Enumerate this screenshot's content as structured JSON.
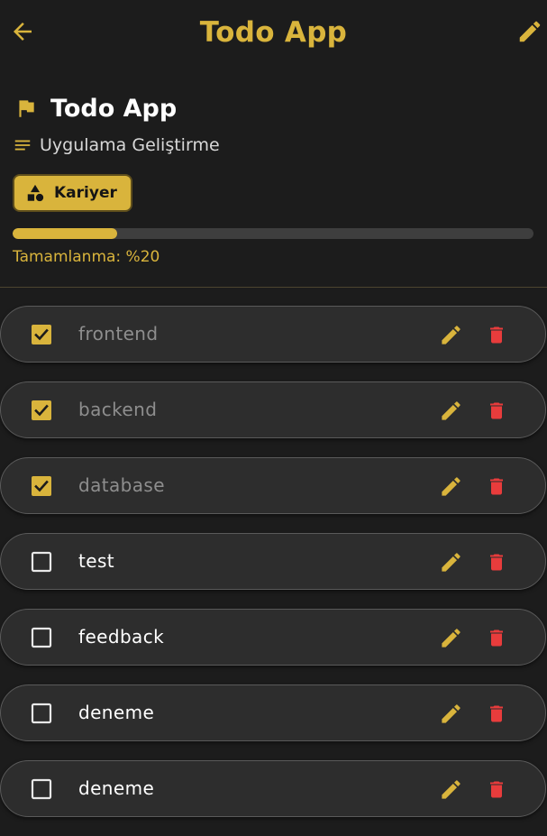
{
  "appbar": {
    "title": "Todo App",
    "back_icon": "arrow-left-icon",
    "edit_icon": "pencil-icon"
  },
  "project": {
    "title": "Todo App",
    "title_icon": "flag-icon",
    "description": "Uygulama Geliştirme",
    "description_icon": "notes-icon",
    "category": "Kariyer",
    "category_icon": "category-icon"
  },
  "progress": {
    "fraction": 0.2,
    "label": "Tamamlanma: %20"
  },
  "colors": {
    "accent": "#d9b43c",
    "background": "#1c1c1c",
    "card": "#2d2d2d",
    "delete": "#e83c3c",
    "done_text": "#8e8e8e"
  },
  "todos": [
    {
      "text": "frontend",
      "done": true
    },
    {
      "text": "backend",
      "done": true
    },
    {
      "text": "database",
      "done": true
    },
    {
      "text": "test",
      "done": false
    },
    {
      "text": "feedback",
      "done": false
    },
    {
      "text": "deneme",
      "done": false
    },
    {
      "text": "deneme",
      "done": false
    }
  ]
}
